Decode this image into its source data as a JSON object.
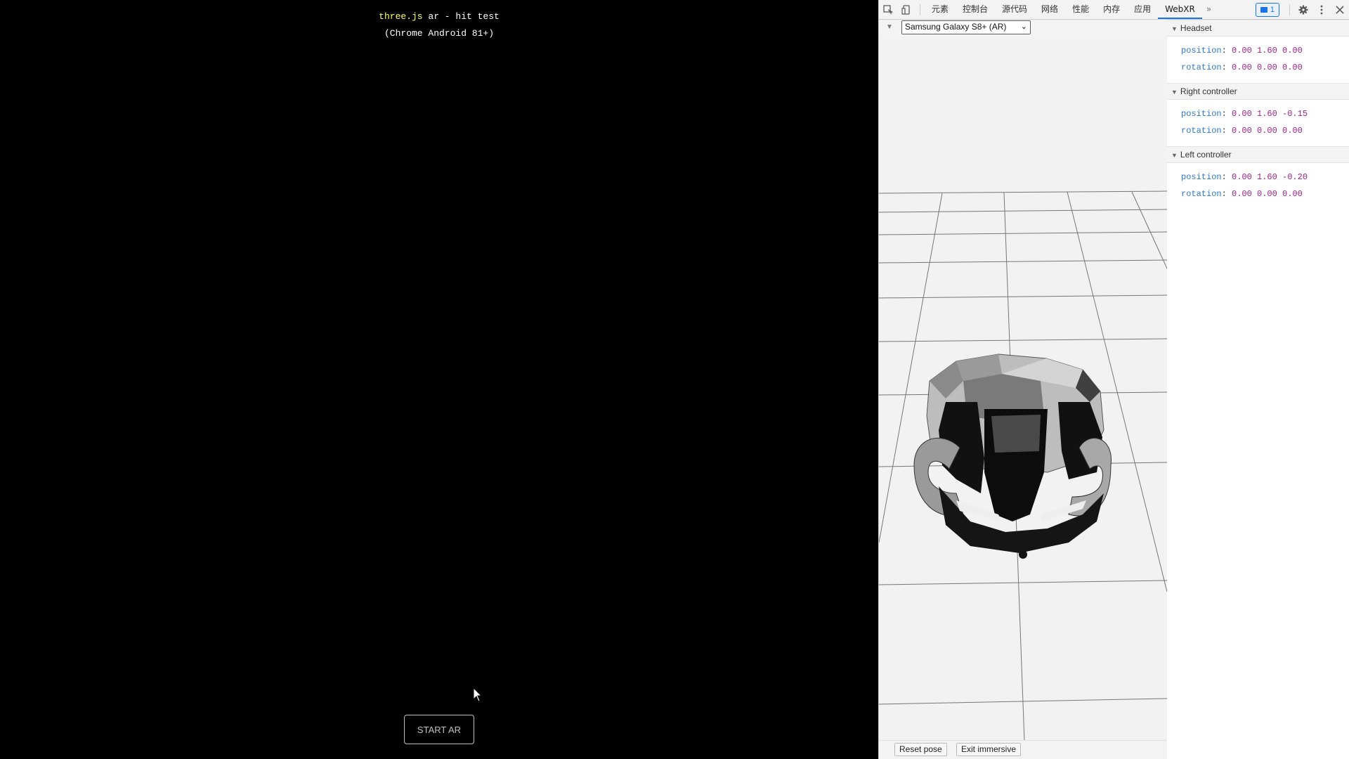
{
  "page": {
    "link_text": "three.js",
    "title_rest": " ar - hit test",
    "subtitle": "(Chrome Android 81+)",
    "start_button": "START AR"
  },
  "devtools": {
    "tabs": [
      {
        "label": "元素"
      },
      {
        "label": "控制台"
      },
      {
        "label": "源代码"
      },
      {
        "label": "网络"
      },
      {
        "label": "性能"
      },
      {
        "label": "内存"
      },
      {
        "label": "应用"
      },
      {
        "label": "WebXR",
        "active": true
      }
    ],
    "more_tabs_glyph": "»",
    "issues_count": "1",
    "device": "Samsung Galaxy S8+ (AR)",
    "reset_pose": "Reset pose",
    "exit_immersive": "Exit immersive",
    "sections": [
      {
        "title": "Headset",
        "position": "0.00 1.60 0.00",
        "rotation": "0.00 0.00 0.00"
      },
      {
        "title": "Right controller",
        "position": "0.00 1.60 -0.15",
        "rotation": "0.00 0.00 0.00"
      },
      {
        "title": "Left controller",
        "position": "0.00 1.60 -0.20",
        "rotation": "0.00 0.00 0.00"
      }
    ],
    "pose_labels": {
      "position": "position",
      "rotation": "rotation"
    }
  },
  "icons": [
    "inspect-icon",
    "device-toggle-icon",
    "settings-icon",
    "more-vert-icon",
    "close-icon",
    "cursor-icon"
  ],
  "colors": {
    "accent": "#1a73e8",
    "key": "#2a78c9",
    "value": "#a11e8a",
    "link": "#ffff66"
  }
}
